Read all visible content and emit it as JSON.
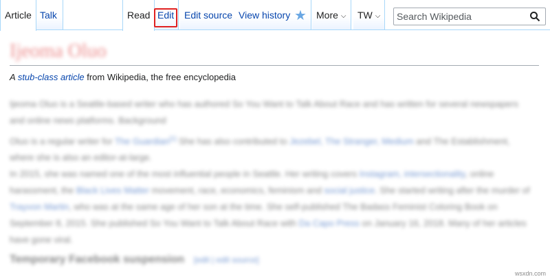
{
  "tabs": {
    "article": "Article",
    "talk": "Talk",
    "read": "Read",
    "edit": "Edit",
    "edit_source": "Edit source",
    "view_history": "View history",
    "more": "More",
    "tw": "TW"
  },
  "search": {
    "placeholder": "Search Wikipedia"
  },
  "article": {
    "title": "Ijeoma Oluo",
    "subtitle_prefix": "A ",
    "subtitle_link": "stub-class article",
    "subtitle_suffix": " from Wikipedia, the free encyclopedia",
    "para1": "Ijeoma Oluo is a Seattle-based writer who has authored So You Want to Talk About Race and has written for several newspapers and online news platforms. Background",
    "para2_a": "Oluo is a regular writer for ",
    "para2_l1": "The Guardian",
    "para2_b": " She has also contributed to ",
    "para2_l2": "Jezebel, The Stranger, Medium",
    "para2_c": " and The Establishment, where she is also an editor-at-large.",
    "para3_a": "In 2015, she was named one of the most influential people in Seattle. Her writing covers ",
    "para3_l1": "Instagram, intersectionality",
    "para3_b": ", online harassment, the ",
    "para3_l2": "Black Lives Matter",
    "para3_c": " movement, race, economics, feminism and ",
    "para3_l3": "social justice",
    "para3_d": ". She started writing after the murder of ",
    "para3_l4": "Trayvon Martin",
    "para3_e": ", who was at the same age of her son at the time. She self-published The Badass Feminist Coloring Book on September 8, 2015. She published So You Want to Talk About Race with ",
    "para3_l5": "Da Capo Press",
    "para3_f": " on January 16, 2018. Many of her articles have gone viral.",
    "section_heading": "Temporary Facebook suspension",
    "section_edit": "[edit | edit source]"
  },
  "watermark": "wsxdn.com",
  "colors": {
    "link": "#0645ad",
    "tab_border": "#a7d7f9",
    "highlight": "#e02020"
  }
}
